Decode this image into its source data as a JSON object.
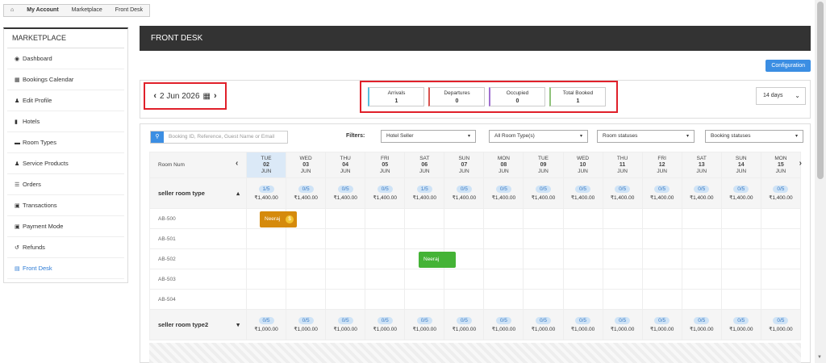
{
  "breadcrumb": {
    "home": "⌂",
    "items": [
      "My Account",
      "Marketplace",
      "Front Desk"
    ]
  },
  "sidebar": {
    "title": "MARKETPLACE",
    "items": [
      {
        "icon": "dashboard-icon",
        "glyph": "◉",
        "label": "Dashboard"
      },
      {
        "icon": "calendar-chart-icon",
        "glyph": "▦",
        "label": "Bookings Calendar"
      },
      {
        "icon": "user-icon",
        "glyph": "♟",
        "label": "Edit Profile"
      },
      {
        "icon": "building-icon",
        "glyph": "▮",
        "label": "Hotels"
      },
      {
        "icon": "bed-icon",
        "glyph": "▬",
        "label": "Room Types"
      },
      {
        "icon": "users-icon",
        "glyph": "♟",
        "label": "Service Products"
      },
      {
        "icon": "orders-icon",
        "glyph": "☰",
        "label": "Orders"
      },
      {
        "icon": "transactions-icon",
        "glyph": "▣",
        "label": "Transactions"
      },
      {
        "icon": "payment-icon",
        "glyph": "▣",
        "label": "Payment Mode"
      },
      {
        "icon": "refund-icon",
        "glyph": "↺",
        "label": "Refunds"
      },
      {
        "icon": "frontdesk-icon",
        "glyph": "▤",
        "label": "Front Desk"
      }
    ]
  },
  "header": {
    "title": "FRONT DESK",
    "config_label": "Configuration"
  },
  "controls": {
    "date": "2 Jun 2026",
    "days": "14 days"
  },
  "stats": [
    {
      "label": "Arrivals",
      "value": "1",
      "color": "#5bc0de"
    },
    {
      "label": "Departures",
      "value": "0",
      "color": "#d9534f"
    },
    {
      "label": "Occupied",
      "value": "0",
      "color": "#a070d0"
    },
    {
      "label": "Total Booked",
      "value": "1",
      "color": "#8fc27a"
    }
  ],
  "filters": {
    "search_placeholder": "Booking ID, Reference, Guest Name or Email",
    "label": "Filters:",
    "hotel": "Hotel Seller",
    "room_type": "All Room Type(s)",
    "room_status": "Room statuses",
    "booking_status": "Booking statuses"
  },
  "calendar": {
    "col_header": "Room Num",
    "days": [
      {
        "dow": "TUE",
        "d": "02",
        "m": "JUN"
      },
      {
        "dow": "WED",
        "d": "03",
        "m": "JUN"
      },
      {
        "dow": "THU",
        "d": "04",
        "m": "JUN"
      },
      {
        "dow": "FRI",
        "d": "05",
        "m": "JUN"
      },
      {
        "dow": "SAT",
        "d": "06",
        "m": "JUN"
      },
      {
        "dow": "SUN",
        "d": "07",
        "m": "JUN"
      },
      {
        "dow": "MON",
        "d": "08",
        "m": "JUN"
      },
      {
        "dow": "TUE",
        "d": "09",
        "m": "JUN"
      },
      {
        "dow": "WED",
        "d": "10",
        "m": "JUN"
      },
      {
        "dow": "THU",
        "d": "11",
        "m": "JUN"
      },
      {
        "dow": "FRI",
        "d": "12",
        "m": "JUN"
      },
      {
        "dow": "SAT",
        "d": "13",
        "m": "JUN"
      },
      {
        "dow": "SUN",
        "d": "14",
        "m": "JUN"
      },
      {
        "dow": "MON",
        "d": "15",
        "m": "JUN"
      }
    ],
    "types": [
      {
        "name": "seller room type",
        "avail": [
          "1/5",
          "0/5",
          "0/5",
          "0/5",
          "1/5",
          "0/5",
          "0/5",
          "0/5",
          "0/5",
          "0/5",
          "0/5",
          "0/5",
          "0/5",
          "0/5"
        ],
        "price": "₹1,400.00",
        "rooms": [
          "AB-500",
          "AB-501",
          "AB-502",
          "AB-503",
          "AB-504"
        ]
      },
      {
        "name": "seller room type2",
        "avail": [
          "0/5",
          "0/5",
          "0/5",
          "0/5",
          "0/5",
          "0/5",
          "0/5",
          "0/5",
          "0/5",
          "0/5",
          "0/5",
          "0/5",
          "0/5",
          "0/5"
        ],
        "price": "₹1,000.00",
        "rooms": []
      }
    ],
    "bookings": [
      {
        "guest": "Neeraj",
        "room": "AB-500"
      },
      {
        "guest": "Neeraj",
        "room": "AB-502"
      }
    ]
  }
}
